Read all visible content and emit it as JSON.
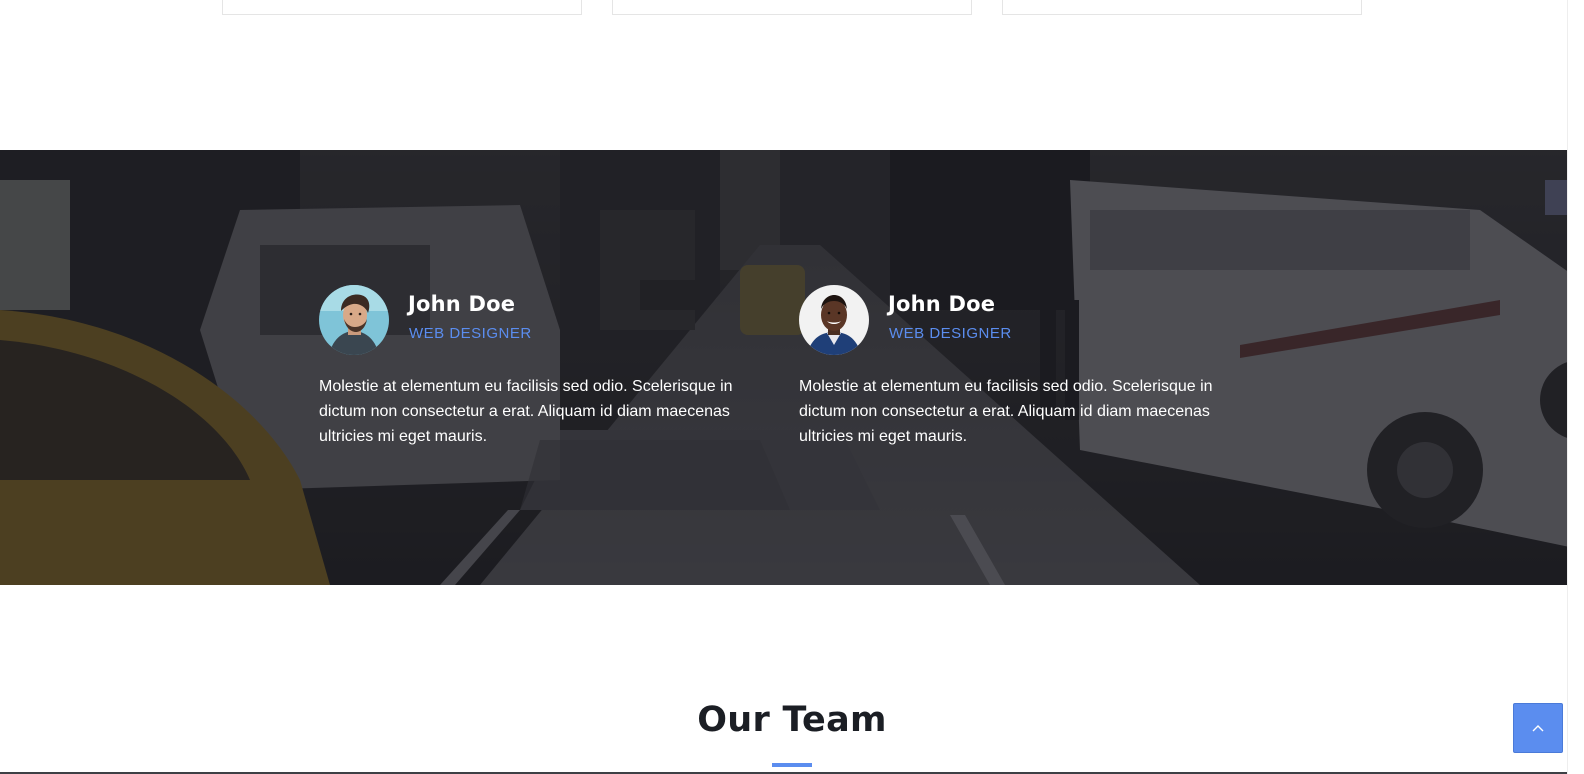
{
  "testimonials": [
    {
      "name": "John Doe",
      "role": "WEB DESIGNER",
      "quote": "Molestie at elementum eu facilisis sed odio. Scelerisque in dictum non consectetur a erat. Aliquam id diam maecenas ultricies mi eget mauris.",
      "avatar": "avatar-man-beard"
    },
    {
      "name": "John Doe",
      "role": "WEB DESIGNER",
      "quote": "Molestie at elementum eu facilisis sed odio. Scelerisque in dictum non consectetur a erat. Aliquam id diam maecenas ultricies mi eget mauris.",
      "avatar": "avatar-man-smiling"
    }
  ],
  "team": {
    "title": "Our Team"
  },
  "back_to_top": {
    "icon": "chevron-up-icon"
  },
  "colors": {
    "accent": "#5b8def",
    "heading": "#1b1e24",
    "band_overlay": "#1c1c20"
  }
}
